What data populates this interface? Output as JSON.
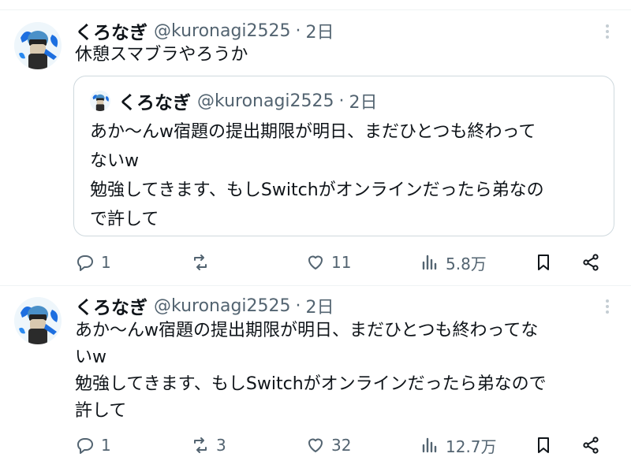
{
  "tweets": [
    {
      "author": {
        "name": "くろなぎ",
        "handle": "@kuronagi2525"
      },
      "separator": "·",
      "time": "2日",
      "text": "休憩スマブラやろうか",
      "quote": {
        "author": {
          "name": "くろなぎ",
          "handle": "@kuronagi2525"
        },
        "separator": "·",
        "time": "2日",
        "text": "あか〜んw宿題の提出期限が明日、まだひとつも終わって\nないw\n勉強してきます、もしSwitchがオンラインだったら弟なの\nで許して"
      },
      "actions": {
        "replies": "1",
        "reposts": "",
        "likes": "11",
        "views": "5.8万"
      }
    },
    {
      "author": {
        "name": "くろなぎ",
        "handle": "@kuronagi2525"
      },
      "separator": "·",
      "time": "2日",
      "text": "あか〜んw宿題の提出期限が明日、まだひとつも終わってな\nいw\n勉強してきます、もしSwitchがオンラインだったら弟なので\n許して",
      "actions": {
        "replies": "1",
        "reposts": "3",
        "likes": "32",
        "views": "12.7万"
      }
    }
  ],
  "icons": {
    "reply": "reply-icon",
    "repost": "repost-icon",
    "like": "heart-icon",
    "views": "views-icon",
    "bookmark": "bookmark-icon",
    "share": "share-icon",
    "more": "more-icon"
  },
  "colors": {
    "text": "#0f1419",
    "secondary": "#536471",
    "border": "#cfd9de",
    "divider": "#eff3f4",
    "avatar_accent": "#1d6fe0"
  }
}
